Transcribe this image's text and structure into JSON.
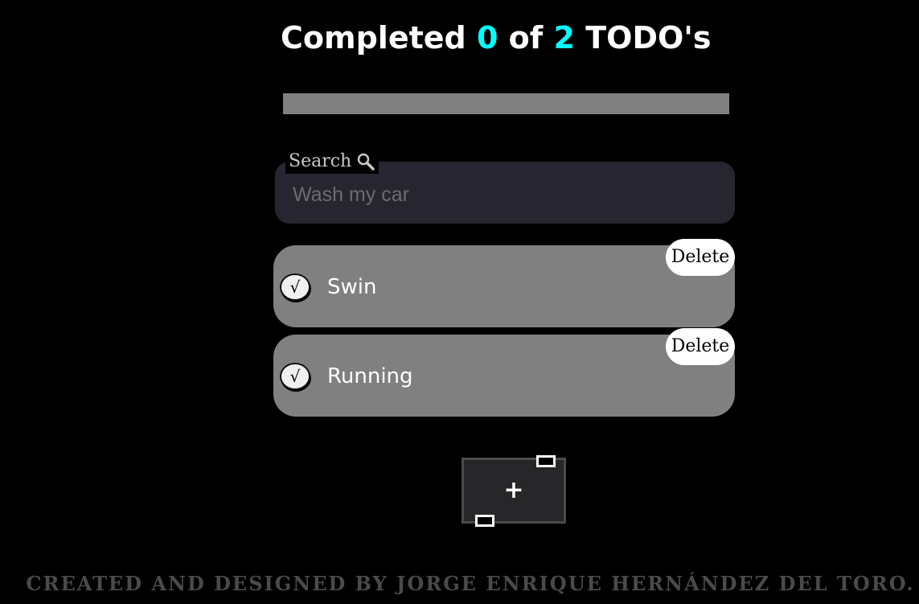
{
  "header": {
    "prefix": "Completed",
    "completed_count": "0",
    "middle": "of",
    "total_count": "2",
    "suffix": "TODO's"
  },
  "progress": {
    "fraction": 0
  },
  "search": {
    "label": "Search",
    "icon": "search-icon",
    "value": "",
    "placeholder": "Wash my car"
  },
  "todos": [
    {
      "text": "Swin",
      "completed": false,
      "check_glyph": "√",
      "delete_label": "Delete"
    },
    {
      "text": "Running",
      "completed": false,
      "check_glyph": "√",
      "delete_label": "Delete"
    }
  ],
  "add_button": {
    "label": "+"
  },
  "footer": {
    "credit": "CREATED AND DESIGNED BY JORGE ENRIQUE HERNÁNDEZ DEL TORO."
  },
  "colors": {
    "background": "#000000",
    "accent": "#00ffff",
    "todo_card": "#808080",
    "search_box": "#27252f"
  }
}
